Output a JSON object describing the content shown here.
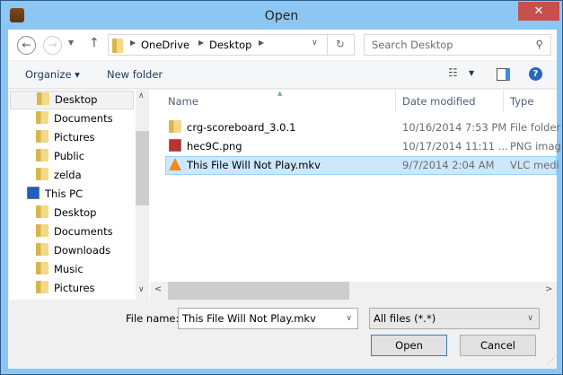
{
  "window": {
    "title": "Open",
    "close": "✕"
  },
  "nav": {
    "back": "←",
    "forward": "→",
    "up": "↑",
    "breadcrumb": [
      "OneDrive",
      "Desktop"
    ],
    "search_placeholder": "Search Desktop"
  },
  "toolbar": {
    "organize": "Organize ▾",
    "new_folder": "New folder",
    "help": "?"
  },
  "sidebar": {
    "items": [
      {
        "label": "Desktop",
        "selected": true
      },
      {
        "label": "Documents"
      },
      {
        "label": "Pictures"
      },
      {
        "label": "Public"
      },
      {
        "label": "zelda"
      },
      {
        "label": "This PC"
      },
      {
        "label": "Desktop"
      },
      {
        "label": "Documents"
      },
      {
        "label": "Downloads"
      },
      {
        "label": "Music"
      },
      {
        "label": "Pictures"
      }
    ]
  },
  "columns": {
    "name": "Name",
    "date": "Date modified",
    "type": "Type"
  },
  "files": [
    {
      "name": "crg-scoreboard_3.0.1",
      "date": "10/16/2014 7:53 PM",
      "type": "File folder"
    },
    {
      "name": "hec9C.png",
      "date": "10/17/2014 11:11 ...",
      "type": "PNG imag"
    },
    {
      "name": "This File Will Not Play.mkv",
      "date": "9/7/2014 2:04 AM",
      "type": "VLC medi",
      "selected": true
    }
  ],
  "footer": {
    "filename_label": "File name:",
    "filename_value": "This File Will Not Play.mkv",
    "filter": "All files (*.*)",
    "open": "Open",
    "cancel": "Cancel"
  }
}
